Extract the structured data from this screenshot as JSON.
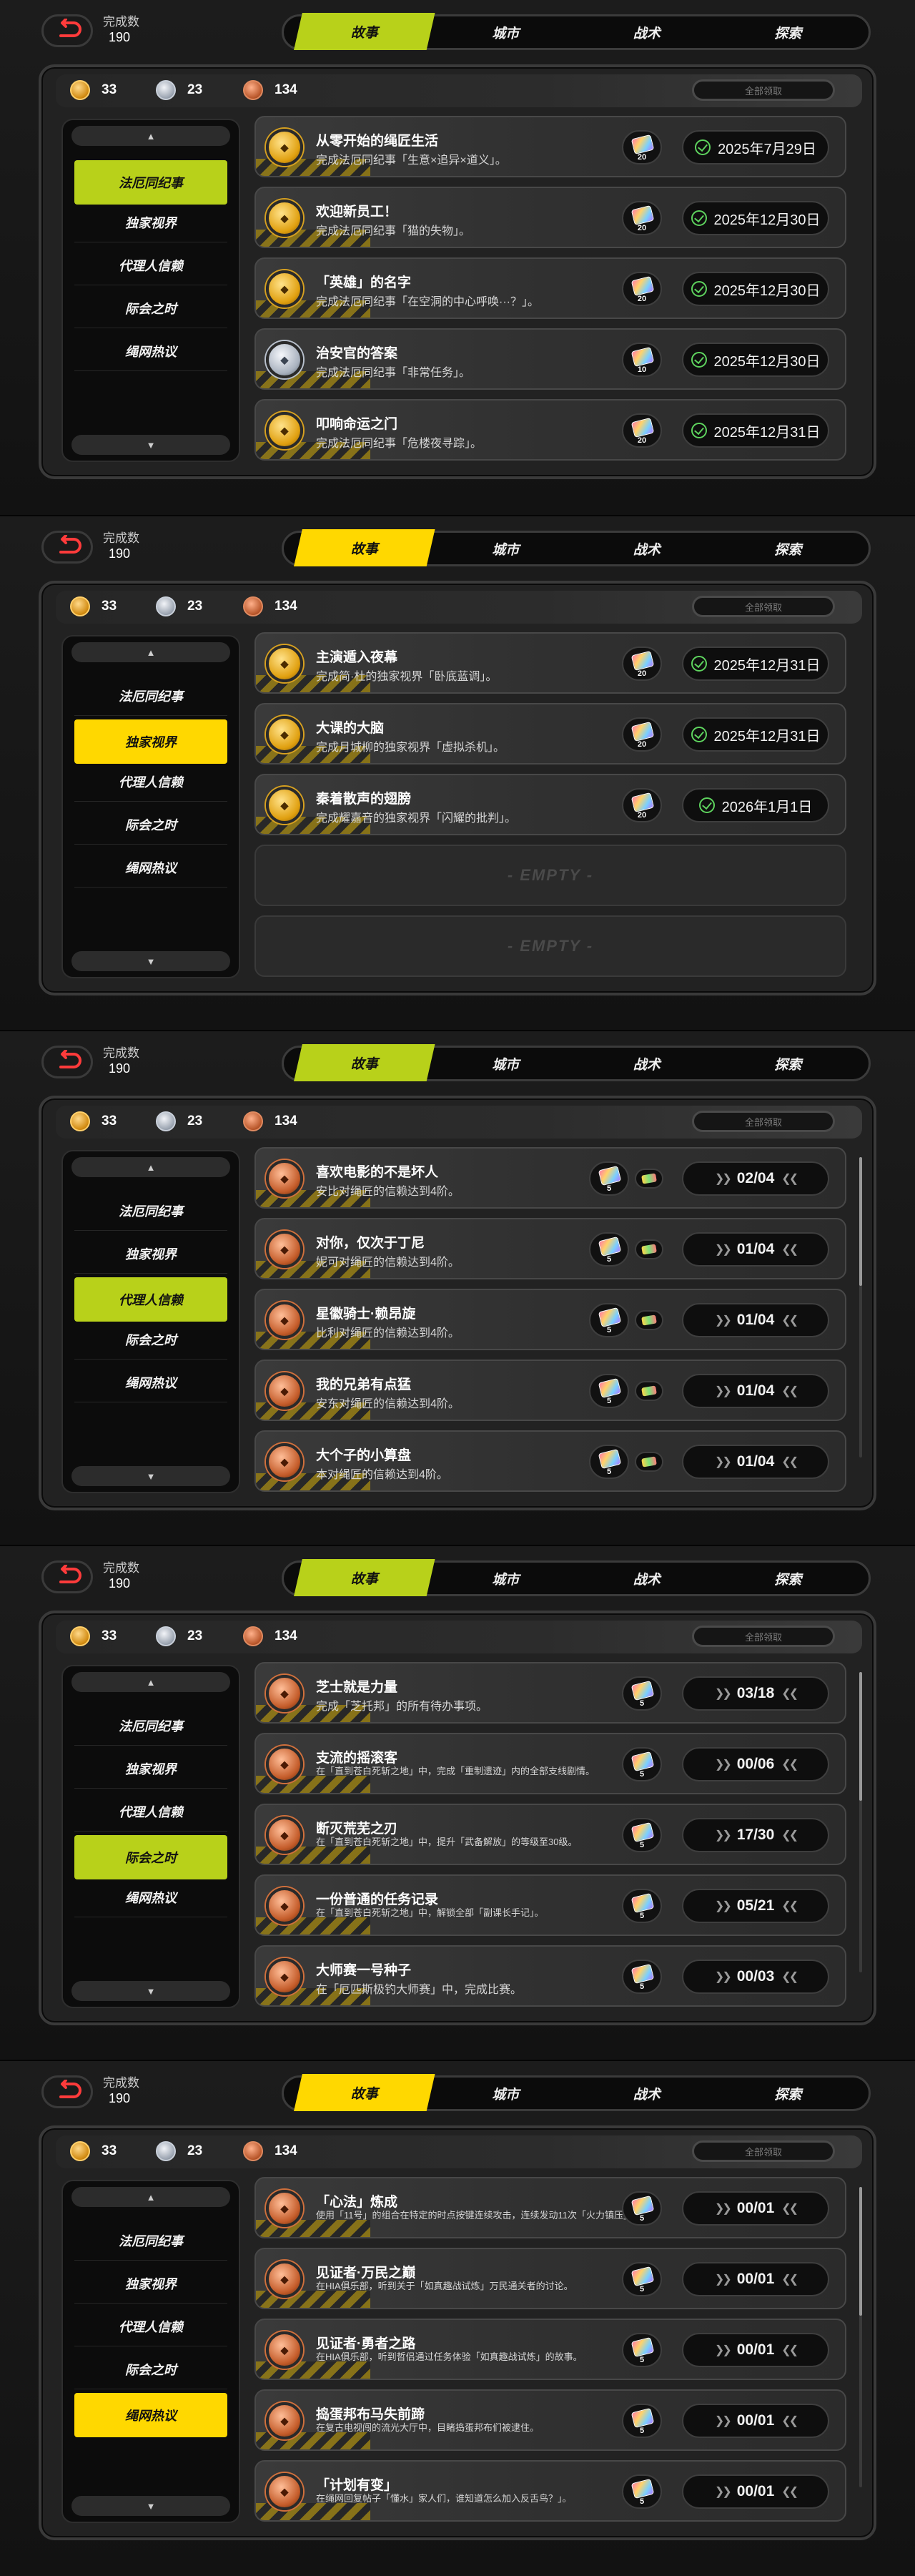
{
  "accent_colors": [
    "#b8d11a",
    "#ffd800",
    "#b8d11a",
    "#b8d11a",
    "#ffd800"
  ],
  "frames": [
    {
      "header": {
        "count_label": "完成数",
        "count_value": "190"
      },
      "tabs": [
        "故事",
        "城市",
        "战术",
        "探索"
      ],
      "active_tab": 0,
      "currency": {
        "gold": "33",
        "silver": "23",
        "bronze": "134",
        "claim_all": "全部领取"
      },
      "sidebar": {
        "items": [
          "法厄同纪事",
          "独家视界",
          "代理人信赖",
          "际会之时",
          "绳网热议"
        ],
        "active": 0
      },
      "show_scrollbar": false,
      "rows": [
        {
          "medal": "gold",
          "title": "从零开始的绳匠生活",
          "desc": "完成法厄同纪事「生意×追异×道义」。",
          "reward": "20",
          "status": "2025年7月29日",
          "kind": "date"
        },
        {
          "medal": "gold",
          "title": "欢迎新员工！",
          "desc": "完成法厄同纪事「猫的失物」。",
          "reward": "20",
          "status": "2025年12月30日",
          "kind": "date"
        },
        {
          "medal": "gold",
          "title": "「英雄」的名字",
          "desc": "完成法厄同纪事「在空洞的中心呼唤···？」。",
          "reward": "20",
          "status": "2025年12月30日",
          "kind": "date"
        },
        {
          "medal": "silver",
          "title": "治安官的答案",
          "desc": "完成法厄同纪事「非常任务」。",
          "reward": "10",
          "status": "2025年12月30日",
          "kind": "date"
        },
        {
          "medal": "gold",
          "title": "叩响命运之门",
          "desc": "完成法厄同纪事「危楼夜寻踪」。",
          "reward": "20",
          "status": "2025年12月31日",
          "kind": "date"
        }
      ]
    },
    {
      "header": {
        "count_label": "完成数",
        "count_value": "190"
      },
      "tabs": [
        "故事",
        "城市",
        "战术",
        "探索"
      ],
      "active_tab": 0,
      "currency": {
        "gold": "33",
        "silver": "23",
        "bronze": "134",
        "claim_all": "全部领取"
      },
      "sidebar": {
        "items": [
          "法厄同纪事",
          "独家视界",
          "代理人信赖",
          "际会之时",
          "绳网热议"
        ],
        "active": 1
      },
      "show_scrollbar": false,
      "rows": [
        {
          "medal": "gold",
          "title": "主演遁入夜幕",
          "desc": "完成简·杜的独家视界「卧底蓝调」。",
          "reward": "20",
          "status": "2025年12月31日",
          "kind": "date"
        },
        {
          "medal": "gold",
          "title": "大课的大脑",
          "desc": "完成月城柳的独家视界「虚拟杀机」。",
          "reward": "20",
          "status": "2025年12月31日",
          "kind": "date"
        },
        {
          "medal": "gold",
          "title": "秦着散声的翅膀",
          "desc": "完成耀嘉音的独家视界「闪耀的批判」。",
          "reward": "20",
          "status": "2026年1月1日",
          "kind": "date"
        },
        {
          "empty": true,
          "label": "- EMPTY -"
        },
        {
          "empty": true,
          "label": "- EMPTY -"
        }
      ]
    },
    {
      "header": {
        "count_label": "完成数",
        "count_value": "190"
      },
      "tabs": [
        "故事",
        "城市",
        "战术",
        "探索"
      ],
      "active_tab": 0,
      "currency": {
        "gold": "33",
        "silver": "23",
        "bronze": "134",
        "claim_all": "全部领取"
      },
      "sidebar": {
        "items": [
          "法厄同纪事",
          "独家视界",
          "代理人信赖",
          "际会之时",
          "绳网热议"
        ],
        "active": 2
      },
      "show_scrollbar": true,
      "rows": [
        {
          "medal": "bronze",
          "title": "喜欢电影的不是坏人",
          "desc": "安比对绳匠的信赖达到4阶。",
          "reward": "5",
          "bonus": true,
          "status": "02/04",
          "kind": "progress"
        },
        {
          "medal": "bronze",
          "title": "对你，仅次于丁尼",
          "desc": "妮可对绳匠的信赖达到4阶。",
          "reward": "5",
          "bonus": true,
          "status": "01/04",
          "kind": "progress"
        },
        {
          "medal": "bronze",
          "title": "星徽骑士·赖昂旋",
          "desc": "比利对绳匠的信赖达到4阶。",
          "reward": "5",
          "bonus": true,
          "status": "01/04",
          "kind": "progress"
        },
        {
          "medal": "bronze",
          "title": "我的兄弟有点猛",
          "desc": "安东对绳匠的信赖达到4阶。",
          "reward": "5",
          "bonus": true,
          "status": "01/04",
          "kind": "progress"
        },
        {
          "medal": "bronze",
          "title": "大个子的小算盘",
          "desc": "本对绳匠的信赖达到4阶。",
          "reward": "5",
          "bonus": true,
          "status": "01/04",
          "kind": "progress"
        }
      ]
    },
    {
      "header": {
        "count_label": "完成数",
        "count_value": "190"
      },
      "tabs": [
        "故事",
        "城市",
        "战术",
        "探索"
      ],
      "active_tab": 0,
      "currency": {
        "gold": "33",
        "silver": "23",
        "bronze": "134",
        "claim_all": "全部领取"
      },
      "sidebar": {
        "items": [
          "法厄同纪事",
          "独家视界",
          "代理人信赖",
          "际会之时",
          "绳网热议"
        ],
        "active": 3
      },
      "show_scrollbar": true,
      "rows": [
        {
          "medal": "bronze",
          "title": "芝士就是力量",
          "desc": "完成「芝托邦」的所有待办事项。",
          "reward": "5",
          "status": "03/18",
          "kind": "progress"
        },
        {
          "medal": "bronze",
          "title": "支流的摇滚客",
          "desc": "在「直到苍白死斩之地」中，完成「重制遗迹」内的全部支线剧情。",
          "reward": "5",
          "status": "00/06",
          "kind": "progress",
          "small": true
        },
        {
          "medal": "bronze",
          "title": "断灭荒芜之刃",
          "desc": "在「直到苍白死斩之地」中，提升「武备解放」的等级至30级。",
          "reward": "5",
          "status": "17/30",
          "kind": "progress",
          "small": true
        },
        {
          "medal": "bronze",
          "title": "一份普通的任务记录",
          "desc": "在「直到苍白死斩之地」中，解锁全部「副课长手记」。",
          "reward": "5",
          "status": "05/21",
          "kind": "progress",
          "small": true
        },
        {
          "medal": "bronze",
          "title": "大师赛一号种子",
          "desc": "在「厄匹斯极钓大师赛」中，完成比赛。",
          "reward": "5",
          "status": "00/03",
          "kind": "progress"
        }
      ]
    },
    {
      "header": {
        "count_label": "完成数",
        "count_value": "190"
      },
      "tabs": [
        "故事",
        "城市",
        "战术",
        "探索"
      ],
      "active_tab": 0,
      "currency": {
        "gold": "33",
        "silver": "23",
        "bronze": "134",
        "claim_all": "全部领取"
      },
      "sidebar": {
        "items": [
          "法厄同纪事",
          "独家视界",
          "代理人信赖",
          "际会之时",
          "绳网热议"
        ],
        "active": 4
      },
      "show_scrollbar": true,
      "rows": [
        {
          "medal": "bronze",
          "title": "「心法」炼成",
          "desc": "使用「11号」的组合在特定的时点按键连续攻击，连续发动11次「火力镇压」。",
          "reward": "5",
          "status": "00/01",
          "kind": "progress",
          "small": true
        },
        {
          "medal": "bronze",
          "title": "见证者·万民之巅",
          "desc": "在HIA俱乐部，听到关于「如真趣战试炼」万民通关者的讨论。",
          "reward": "5",
          "status": "00/01",
          "kind": "progress",
          "small": true
        },
        {
          "medal": "bronze",
          "title": "见证者·勇者之路",
          "desc": "在HIA俱乐部，听到哲侣通过任务体验「如真趣战试炼」的故事。",
          "reward": "5",
          "status": "00/01",
          "kind": "progress",
          "small": true
        },
        {
          "medal": "bronze",
          "title": "捣蛋邦布马失前蹄",
          "desc": "在复古电视闯的流光大厅中，目睹捣蛋邦布们被逮住。",
          "reward": "5",
          "status": "00/01",
          "kind": "progress",
          "small": true
        },
        {
          "medal": "bronze",
          "title": "「计划有变」",
          "desc": "在绳网回复帖子「懂水」家人们，谁知道怎么加入反舌鸟？」。",
          "reward": "5",
          "status": "00/01",
          "kind": "progress",
          "small": true
        }
      ]
    }
  ]
}
